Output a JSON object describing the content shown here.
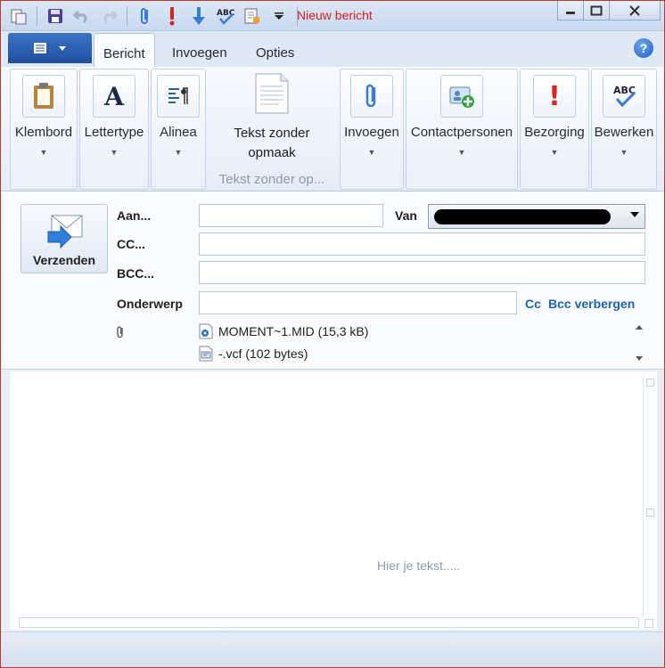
{
  "window": {
    "title": "Nieuw bericht",
    "accent": "#1d4f9e",
    "border_color": "#c0392b"
  },
  "quick_access": {
    "icons": [
      "paste-special-icon",
      "save-icon",
      "undo-icon",
      "redo-icon",
      "attach-icon",
      "priority-high-icon",
      "priority-low-icon",
      "spelling-icon",
      "page-setup-icon",
      "customize-dropdown-icon"
    ],
    "spelling_glyph": "ABC"
  },
  "tabs": {
    "items": [
      {
        "label": "Bericht",
        "active": true
      },
      {
        "label": "Invoegen",
        "active": false
      },
      {
        "label": "Opties",
        "active": false
      }
    ],
    "help_glyph": "?"
  },
  "ribbon": {
    "groups": [
      {
        "label": "Klembord",
        "icon": "clipboard-icon"
      },
      {
        "label": "Lettertype",
        "icon": "font-icon",
        "glyph": "A"
      },
      {
        "label": "Alinea",
        "icon": "paragraph-icon"
      },
      {
        "label": "Tekst zonder opmaak",
        "icon": "plain-text-icon",
        "group_label": "Tekst zonder op..."
      },
      {
        "label": "Invoegen",
        "icon": "paperclip-icon"
      },
      {
        "label": "Contactpersonen",
        "icon": "contacts-icon"
      },
      {
        "label": "Bezorging",
        "icon": "priority-icon",
        "glyph": "!"
      },
      {
        "label": "Bewerken",
        "icon": "spellcheck-icon",
        "glyph": "ABC"
      }
    ]
  },
  "compose": {
    "send_label": "Verzenden",
    "to_label": "Aan...",
    "to_value": "",
    "cc_label": "CC...",
    "cc_value": "",
    "bcc_label": "BCC...",
    "bcc_value": "",
    "subject_label": "Onderwerp",
    "subject_value": "",
    "from_label": "Van",
    "cc_link": "Cc",
    "bcc_hide_link": "Bcc verbergen",
    "attachments": [
      {
        "name": "MOMENT~1.MID (15,3 kB)",
        "icon": "midi-file-icon"
      },
      {
        "name": "-.vcf (102 bytes)",
        "icon": "vcard-file-icon"
      }
    ]
  },
  "body": {
    "placeholder": "Hier je tekst....."
  }
}
